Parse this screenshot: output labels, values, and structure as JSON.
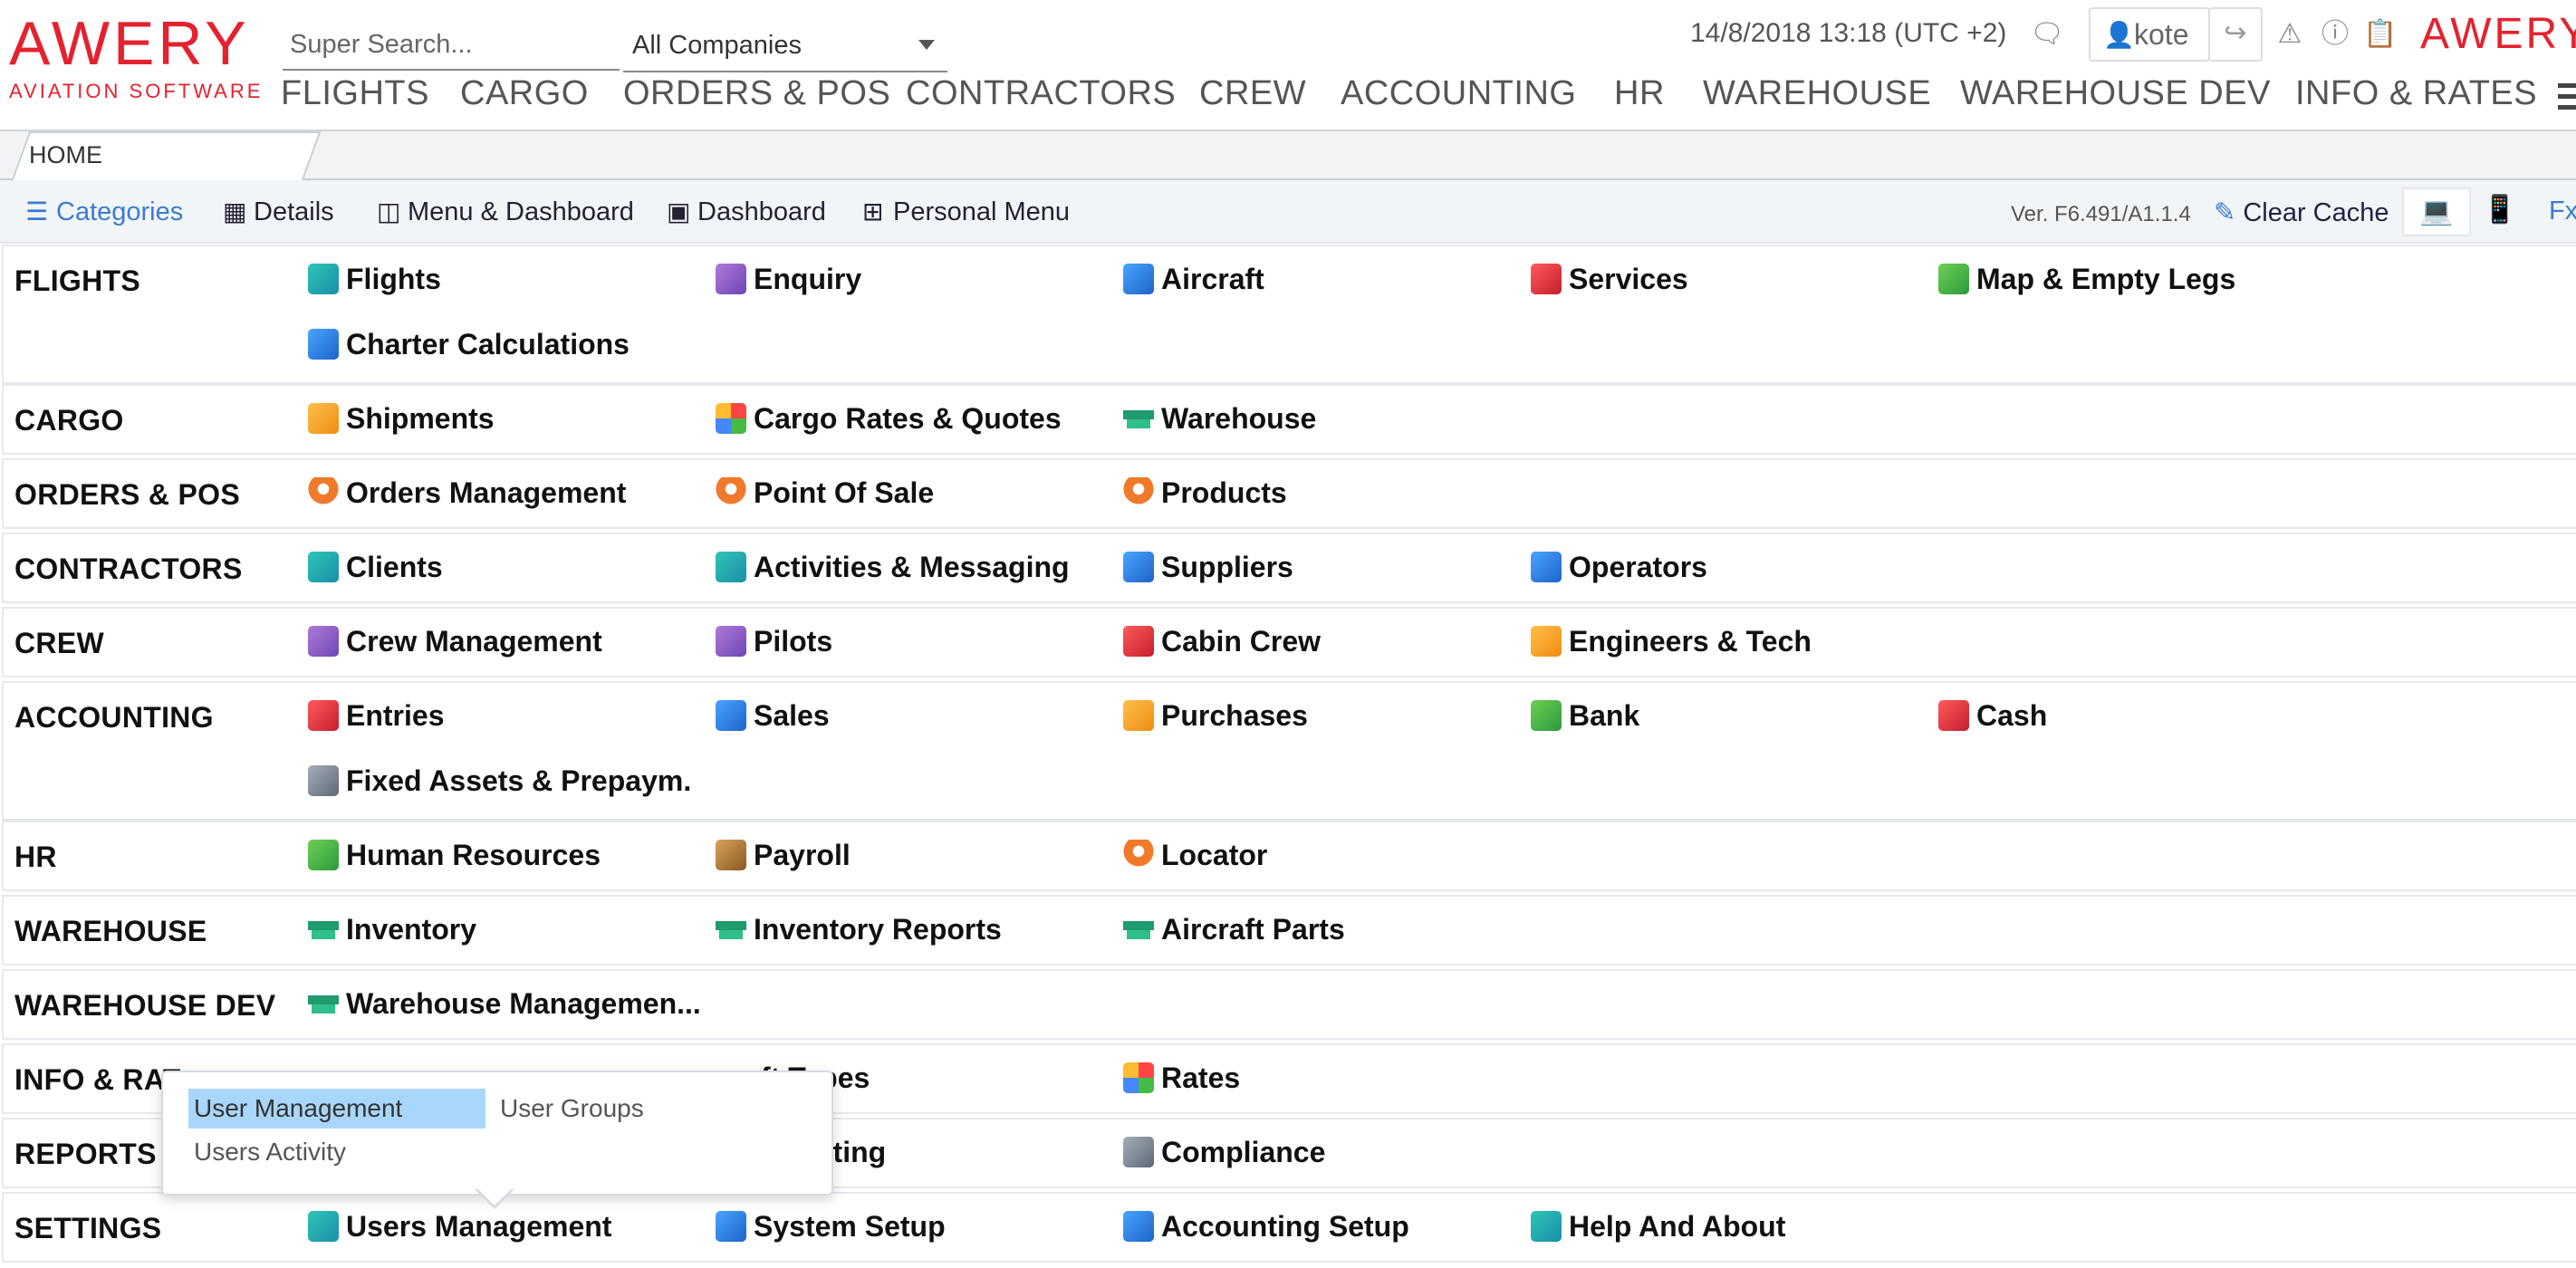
{
  "brand": {
    "logo_main": "AWERY",
    "logo_sub": "AVIATION SOFTWARE",
    "logo_right": "AWERY",
    "color": "#e4222f"
  },
  "search": {
    "placeholder": "Super Search..."
  },
  "company_select": {
    "value": "All Companies"
  },
  "datetime": "14/8/2018 13:18 (UTC +2)",
  "user": {
    "name": "kote"
  },
  "header_icons": [
    "chat-icon",
    "user-icon",
    "logout-icon",
    "warning-icon",
    "help-icon",
    "notes-icon"
  ],
  "main_nav": [
    "FLIGHTS",
    "CARGO",
    "ORDERS & POS",
    "CONTRACTORS",
    "CREW",
    "ACCOUNTING",
    "HR",
    "WAREHOUSE",
    "WAREHOUSE DEV",
    "INFO & RATES"
  ],
  "tab": {
    "label": "HOME"
  },
  "toolbar": {
    "items": [
      "Categories",
      "Details",
      "Menu & Dashboard",
      "Dashboard",
      "Personal Menu"
    ],
    "active": "Categories",
    "version": "Ver. F6.491/A1.1.4",
    "clear_cache": "Clear Cache",
    "fx": "Fx"
  },
  "categories": [
    {
      "label": "FLIGHTS",
      "modules": [
        {
          "name": "Flights",
          "icon": "flights-icon"
        },
        {
          "name": "Enquiry",
          "icon": "enquiry-icon"
        },
        {
          "name": "Aircraft",
          "icon": "aircraft-icon"
        },
        {
          "name": "Services",
          "icon": "services-icon"
        },
        {
          "name": "Map & Empty Legs",
          "icon": "map-icon"
        },
        {
          "name": "Charter Calculations",
          "icon": "calculator-icon"
        }
      ]
    },
    {
      "label": "CARGO",
      "modules": [
        {
          "name": "Shipments",
          "icon": "box-icon"
        },
        {
          "name": "Cargo Rates & Quotes",
          "icon": "rates-icon"
        },
        {
          "name": "Warehouse",
          "icon": "warehouse-icon"
        }
      ]
    },
    {
      "label": "ORDERS & POS",
      "modules": [
        {
          "name": "Orders Management",
          "icon": "pin-icon"
        },
        {
          "name": "Point Of Sale",
          "icon": "pin-icon"
        },
        {
          "name": "Products",
          "icon": "pin-icon"
        }
      ]
    },
    {
      "label": "CONTRACTORS",
      "modules": [
        {
          "name": "Clients",
          "icon": "client-icon"
        },
        {
          "name": "Activities & Messaging",
          "icon": "layers-icon"
        },
        {
          "name": "Suppliers",
          "icon": "supplier-icon"
        },
        {
          "name": "Operators",
          "icon": "operator-icon"
        }
      ]
    },
    {
      "label": "CREW",
      "modules": [
        {
          "name": "Crew Management",
          "icon": "crew-icon"
        },
        {
          "name": "Pilots",
          "icon": "pilot-icon"
        },
        {
          "name": "Cabin Crew",
          "icon": "cabin-crew-icon"
        },
        {
          "name": "Engineers & Tech",
          "icon": "engineer-icon"
        }
      ]
    },
    {
      "label": "ACCOUNTING",
      "modules": [
        {
          "name": "Entries",
          "icon": "entries-icon"
        },
        {
          "name": "Sales",
          "icon": "sales-icon"
        },
        {
          "name": "Purchases",
          "icon": "purchases-icon"
        },
        {
          "name": "Bank",
          "icon": "bank-icon"
        },
        {
          "name": "Cash",
          "icon": "cash-icon"
        },
        {
          "name": "Fixed Assets & Prepaym.",
          "icon": "assets-icon"
        }
      ]
    },
    {
      "label": "HR",
      "modules": [
        {
          "name": "Human Resources",
          "icon": "hr-icon"
        },
        {
          "name": "Payroll",
          "icon": "payroll-icon"
        },
        {
          "name": "Locator",
          "icon": "pin-icon"
        }
      ]
    },
    {
      "label": "WAREHOUSE",
      "modules": [
        {
          "name": "Inventory",
          "icon": "warehouse-icon"
        },
        {
          "name": "Inventory Reports",
          "icon": "warehouse-icon"
        },
        {
          "name": "Aircraft Parts",
          "icon": "warehouse-icon"
        }
      ]
    },
    {
      "label": "WAREHOUSE DEV",
      "modules": [
        {
          "name": "Warehouse Managemen...",
          "icon": "warehouse-icon"
        }
      ]
    },
    {
      "label": "INFO & RAT",
      "modules": [
        {
          "name": "ft Types",
          "icon": "aircraft-types-icon"
        },
        {
          "name": "Rates",
          "icon": "rates-icon"
        }
      ]
    },
    {
      "label": "REPORTS",
      "modules": [
        {
          "name": "nting",
          "icon": "accounting-report-icon"
        },
        {
          "name": "Compliance",
          "icon": "compliance-icon"
        }
      ]
    },
    {
      "label": "SETTINGS",
      "modules": [
        {
          "name": "Users Management",
          "icon": "users-icon"
        },
        {
          "name": "System Setup",
          "icon": "system-setup-icon"
        },
        {
          "name": "Accounting Setup",
          "icon": "accounting-setup-icon"
        },
        {
          "name": "Help And About",
          "icon": "help-icon"
        }
      ]
    }
  ],
  "popup": {
    "items": [
      "User Management",
      "User Groups",
      "Users Activity"
    ],
    "highlighted": "User Management"
  }
}
